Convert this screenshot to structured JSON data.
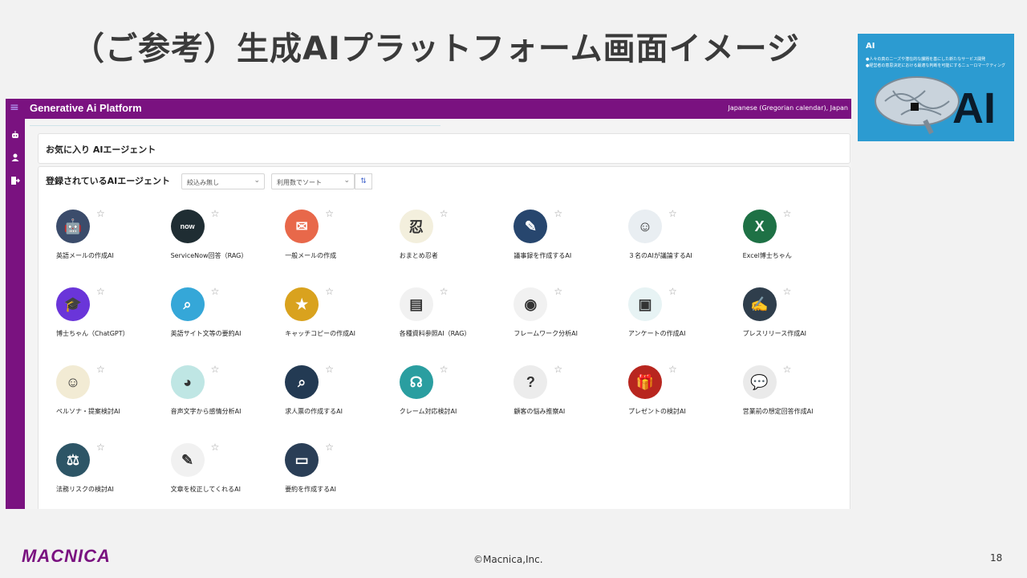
{
  "slide": {
    "title": "（ご参考）生成AIプラットフォーム画面イメージ",
    "copyright": "©Macnica,Inc.",
    "page_number": "18",
    "logo_text": "MACNICA"
  },
  "thumbnail": {
    "heading": "AI",
    "line1": "●人々の真のニーズや潜在的な課題を基にした新たなサービス開発",
    "line2": "●経営者の意思決定における最適な判断を可能にするニューロマーケティング",
    "big_text": "AI"
  },
  "app": {
    "title": "Generative Ai Platform",
    "locale": "Japanese (Gregorian calendar), Japan",
    "favorites_title": "お気に入り AIエージェント",
    "registered_title": "登録されているAIエージェント",
    "filter_value": "絞込み無し",
    "sort_value": "利用数でソート",
    "nav_icons": [
      "robot-icon",
      "user-icon",
      "logout-icon"
    ]
  },
  "agents": [
    {
      "label": "英語メールの作成AI",
      "icon": "robot-photo",
      "color": "#3b4c6b"
    },
    {
      "label": "ServiceNow回答（RAG）",
      "icon": "servicenow-logo",
      "color": "#1f2d33"
    },
    {
      "label": "一般メールの作成",
      "icon": "envelope",
      "color": "#e8684a"
    },
    {
      "label": "おまとめ忍者",
      "icon": "ninja",
      "color": "#f3efdd"
    },
    {
      "label": "議事録を作成するAI",
      "icon": "notepad",
      "color": "#27466e"
    },
    {
      "label": "３名のAIが議論するAI",
      "icon": "three-robots",
      "color": "#e9eef2"
    },
    {
      "label": "Excel博士ちゃん",
      "icon": "excel",
      "color": "#1e7145"
    },
    {
      "label": "博士ちゃん（ChatGPT）",
      "icon": "graduation-cap",
      "color": "#6a35d9"
    },
    {
      "label": "英語サイト文等の要約AI",
      "icon": "document-search",
      "color": "#35a7d8"
    },
    {
      "label": "キャッチコピーの作成AI",
      "icon": "tagline-badge",
      "color": "#d9a21e"
    },
    {
      "label": "各種資料参照AI（RAG）",
      "icon": "book-stack",
      "color": "#f1f1f1"
    },
    {
      "label": "フレームワーク分析AI",
      "icon": "brain-chip",
      "color": "#f1f1f1"
    },
    {
      "label": "アンケートの作成AI",
      "icon": "clipboard-brain",
      "color": "#e7f3f4"
    },
    {
      "label": "プレスリリース作成AI",
      "icon": "press-doc",
      "color": "#2f3e4c"
    },
    {
      "label": "ペルソナ・提案検討AI",
      "icon": "persona",
      "color": "#f2ebd4"
    },
    {
      "label": "音声文字から感情分析AI",
      "icon": "robot-face",
      "color": "#bfe6e4"
    },
    {
      "label": "求人票の作成するAI",
      "icon": "job-search",
      "color": "#233a53"
    },
    {
      "label": "クレーム対応検討AI",
      "icon": "headset-agent",
      "color": "#2a9ea0"
    },
    {
      "label": "顧客の悩み推察AI",
      "icon": "question-head",
      "color": "#ececec"
    },
    {
      "label": "プレゼントの検討AI",
      "icon": "gift-box",
      "color": "#b8261f"
    },
    {
      "label": "営業前の想定回答作成AI",
      "icon": "chat-bubble",
      "color": "#eaeaea"
    },
    {
      "label": "法務リスクの検討AI",
      "icon": "scales",
      "color": "#2d5566"
    },
    {
      "label": "文章を校正してくれるAI",
      "icon": "pen-paper",
      "color": "#f1f1f1"
    },
    {
      "label": "要約を作成するAI",
      "icon": "summary-screen",
      "color": "#2a3e56"
    }
  ]
}
